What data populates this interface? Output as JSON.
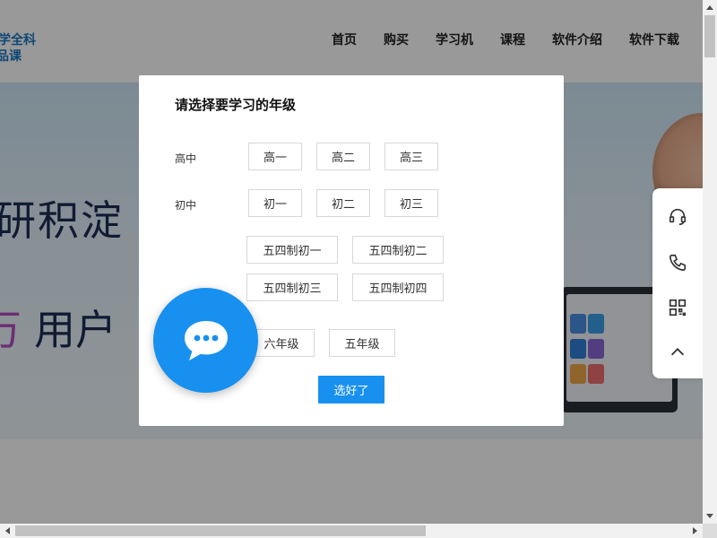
{
  "header": {
    "logo_line1": "学全科",
    "logo_line2": "品课",
    "nav": [
      "首页",
      "购买",
      "学习机",
      "课程",
      "软件介绍",
      "软件下载"
    ]
  },
  "hero": {
    "line1": "研积淀",
    "line2_accent": "万",
    "line2_text": "用户"
  },
  "modal": {
    "title": "请选择要学习的年级",
    "high_label": "高中",
    "middle_label": "初中",
    "high_grades": [
      "高一",
      "高二",
      "高三"
    ],
    "middle_grades": [
      "初一",
      "初二",
      "初三"
    ],
    "wusi_grades": [
      "五四制初一",
      "五四制初二",
      "五四制初三",
      "五四制初四"
    ],
    "primary_grades": [
      "六年级",
      "五年级"
    ],
    "confirm": "选好了"
  },
  "side_tools": {
    "icons": [
      "headset-icon",
      "phone-icon",
      "qrcode-icon",
      "back-to-top-icon"
    ]
  },
  "colors": {
    "accent": "#1890f0",
    "overlay": "rgba(0,0,0,0.4)",
    "logo": "#1a78c2"
  }
}
